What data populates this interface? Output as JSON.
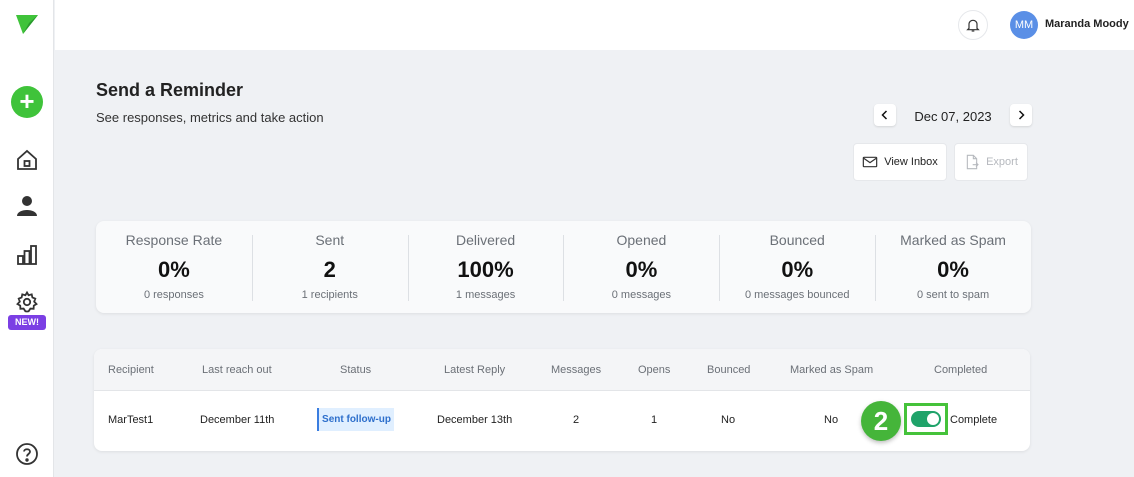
{
  "sidebar": {
    "logo_icon": "triangle-logo-icon",
    "add_icon": "plus-icon",
    "add_label": "+",
    "items": [
      {
        "icon": "home-icon"
      },
      {
        "icon": "user-icon"
      },
      {
        "icon": "bar-chart-icon"
      },
      {
        "icon": "gear-icon",
        "badge": "NEW!"
      }
    ],
    "help_icon": "question-icon"
  },
  "topbar": {
    "bell_icon": "bell-icon",
    "avatar_initials": "MM",
    "user_name": "Maranda Moody"
  },
  "header": {
    "title": "Send a Reminder",
    "subtitle": "See responses, metrics and take action",
    "prev_label": "‹",
    "next_label": "›",
    "date": "Dec 07, 2023",
    "view_inbox_label": "View Inbox",
    "export_label": "Export"
  },
  "metrics": [
    {
      "label": "Response Rate",
      "value": "0%",
      "sub": "0 responses"
    },
    {
      "label": "Sent",
      "value": "2",
      "sub": "1 recipients"
    },
    {
      "label": "Delivered",
      "value": "100%",
      "sub": "1 messages"
    },
    {
      "label": "Opened",
      "value": "0%",
      "sub": "0 messages"
    },
    {
      "label": "Bounced",
      "value": "0%",
      "sub": "0 messages bounced"
    },
    {
      "label": "Marked as Spam",
      "value": "0%",
      "sub": "0 sent to spam"
    }
  ],
  "table": {
    "columns": [
      "Recipient",
      "Last reach out",
      "Status",
      "Latest Reply",
      "Messages",
      "Opens",
      "Bounced",
      "Marked as Spam",
      "Completed"
    ],
    "rows": [
      {
        "recipient": "MarTest1",
        "last_reach_out": "December 11th",
        "status": "Sent follow-up",
        "latest_reply": "December 13th",
        "messages": "2",
        "opens": "1",
        "bounced": "No",
        "marked_as_spam": "No",
        "completed": true,
        "completed_label": "Complete"
      }
    ]
  },
  "annotation": {
    "step": "2"
  },
  "colors": {
    "accent_green": "#3fc33a",
    "toggle_green": "#1fa36a",
    "badge_purple": "#7b3fe4",
    "status_blue": "#2d6fcc"
  }
}
